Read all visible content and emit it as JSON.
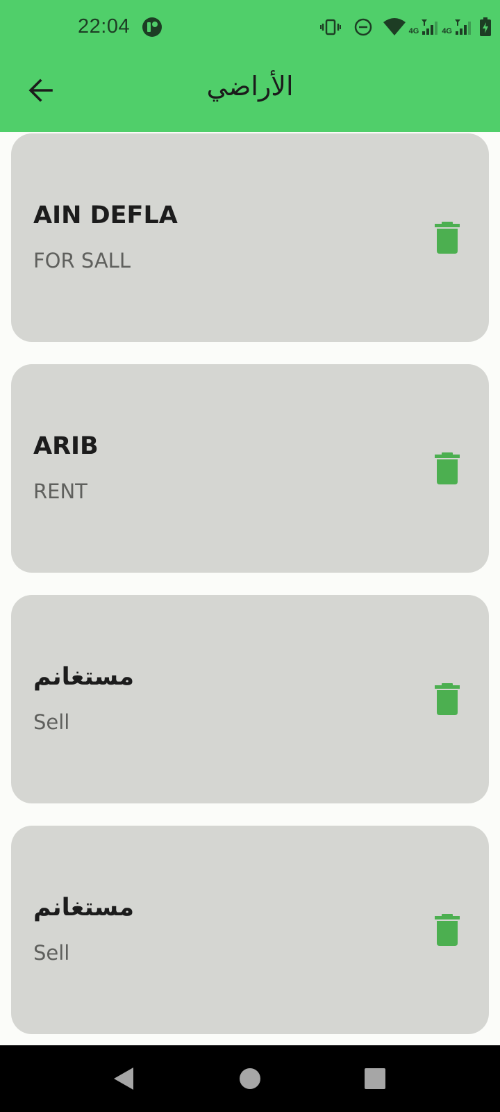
{
  "status_bar": {
    "time": "22:04",
    "icons": [
      "vibrate-icon",
      "do-not-disturb-icon",
      "wifi-icon",
      "signal-4g-1-icon",
      "signal-4g-2-icon",
      "battery-charging-icon"
    ],
    "sim1_label": "4G",
    "sim2_label": "4G"
  },
  "app_bar": {
    "title": "الأراضي",
    "back_icon": "arrow-back-icon"
  },
  "lands": [
    {
      "title": "AIN DEFLA",
      "subtitle": "FOR SALL"
    },
    {
      "title": "ARIB",
      "subtitle": "RENT"
    },
    {
      "title": "مستغانم",
      "subtitle": "Sell"
    },
    {
      "title": "مستغانم",
      "subtitle": "Sell"
    }
  ],
  "colors": {
    "primary": "#50cf6a",
    "card_background": "#d5d6d2",
    "delete_icon": "#4caf50"
  },
  "nav_bar": {
    "buttons": [
      "back-triangle-icon",
      "home-circle-icon",
      "recents-square-icon"
    ]
  }
}
